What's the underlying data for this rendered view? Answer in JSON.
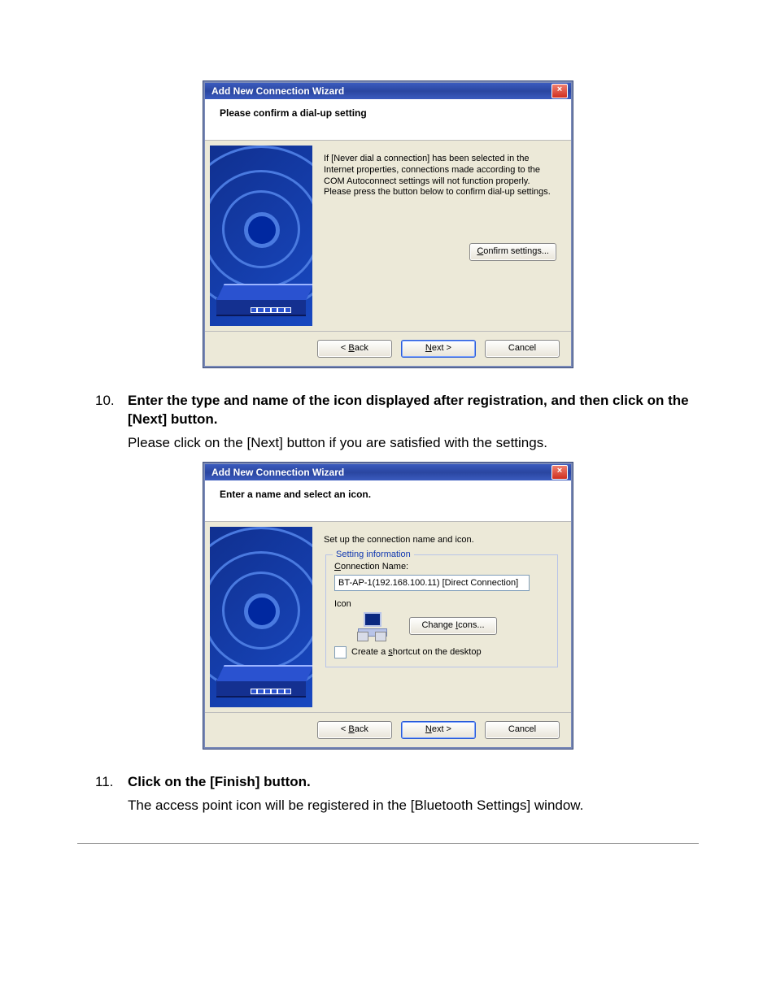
{
  "dialog1": {
    "title": "Add New Connection Wizard",
    "close": "×",
    "heading": "Please confirm a dial-up setting",
    "body_text": "If [Never dial a connection] has been selected in the Internet properties, connections made according to the COM Autoconnect settings will not function properly. Please press the button below to confirm dial-up settings.",
    "confirm_btn": "Confirm settings...",
    "back": "< Back",
    "next": "Next >",
    "cancel": "Cancel"
  },
  "step10": {
    "num": "10.",
    "title": "Enter the type and name of the icon displayed after registration, and then click on the [Next] button.",
    "note": "Please click on the [Next] button if you are satisfied with the settings."
  },
  "dialog2": {
    "title": "Add New Connection Wizard",
    "close": "×",
    "heading": "Enter a name and select an icon.",
    "intro": "Set up the connection name and icon.",
    "group_title": "Setting information",
    "conn_label": "Connection Name:",
    "conn_value": "BT-AP-1(192.168.100.11) [Direct Connection]",
    "icon_label": "Icon",
    "change_btn": "Change Icons...",
    "shortcut": "Create a shortcut on the desktop",
    "back": "< Back",
    "next": "Next >",
    "cancel": "Cancel"
  },
  "step11": {
    "num": "11.",
    "title": "Click on the [Finish] button.",
    "note": "The access point icon will be registered in the [Bluetooth Settings] window."
  }
}
